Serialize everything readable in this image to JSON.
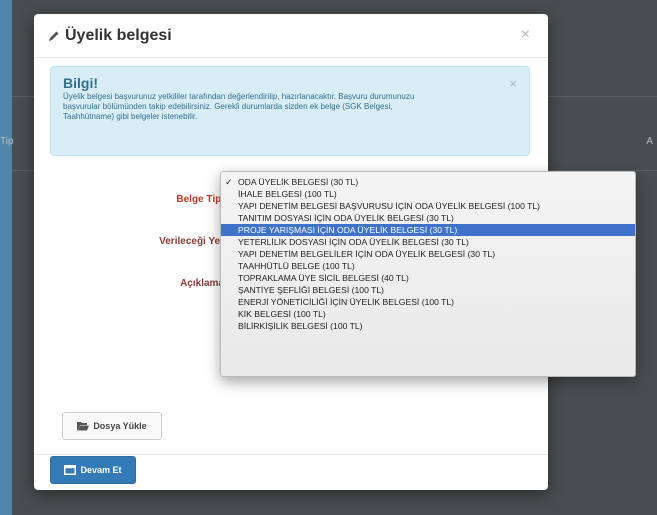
{
  "background": {
    "label_left": "Tip",
    "label_right": "A"
  },
  "modal": {
    "title": "Üyelik belgesi",
    "close_label": "×"
  },
  "alert": {
    "title": "Bilgi!",
    "text": "Üyelik belgesi başvurunuz yetkililer tarafından değerlendirilip, hazırlanacaktır. Başvuru durumunuzu başvurular bölümünden takip edebilirsiniz. Gerekli durumlarda sizden ek belge (SGK Belgesi, Taahhütname) gibi belgeler istenebilir.",
    "close_label": "×"
  },
  "form": {
    "belge_tipi_label": "Belge Tipi",
    "verilecegi_yer_label": "Verileceği Yer",
    "aciklama_label": "Açıklama"
  },
  "dropdown": {
    "selected_index": 0,
    "highlighted_index": 4,
    "options": [
      "ODA ÜYELİK BELGESİ (30 TL)",
      "İHALE BELGESİ (100 TL)",
      "YAPI DENETİM BELGESİ BAŞVURUSU İÇİN ODA ÜYELİK BELGESİ (100 TL)",
      "TANITIM DOSYASI İÇİN ODA ÜYELİK BELGESİ (30 TL)",
      "PROJE YARIŞMASI İÇİN ODA ÜYELİK BELGESİ (30 TL)",
      "YETERLİLİK DOSYASI İÇİN ODA ÜYELİK BELGESİ (30 TL)",
      "YAPI DENETİM BELGELİLER İÇİN ODA ÜYELİK BELGESİ (30 TL)",
      "TAAHHÜTLÜ BELGE (100 TL)",
      "TOPRAKLAMA ÜYE SİCİL BELGESİ (40 TL)",
      "ŞANTİYE ŞEFLİĞİ BELGESİ (100 TL)",
      "ENERJİ YÖNETİCİLİĞİ İÇİN ÜYELİK BELGESİ (100 TL)",
      "KİK BELGESİ (100 TL)",
      "BİLİRKİŞİLİK BELGESİ (100 TL)"
    ]
  },
  "buttons": {
    "upload_label": "Dosya Yükle",
    "continue_label": "Devam Et"
  },
  "icons": {
    "title_icon": "pencil-icon",
    "upload_icon": "folder-open-icon",
    "continue_icon": "window-icon"
  },
  "colors": {
    "primary": "#337ab7",
    "highlight": "#3f72c9",
    "required_label": "#c0392b",
    "alert_bg": "#d9edf7"
  }
}
